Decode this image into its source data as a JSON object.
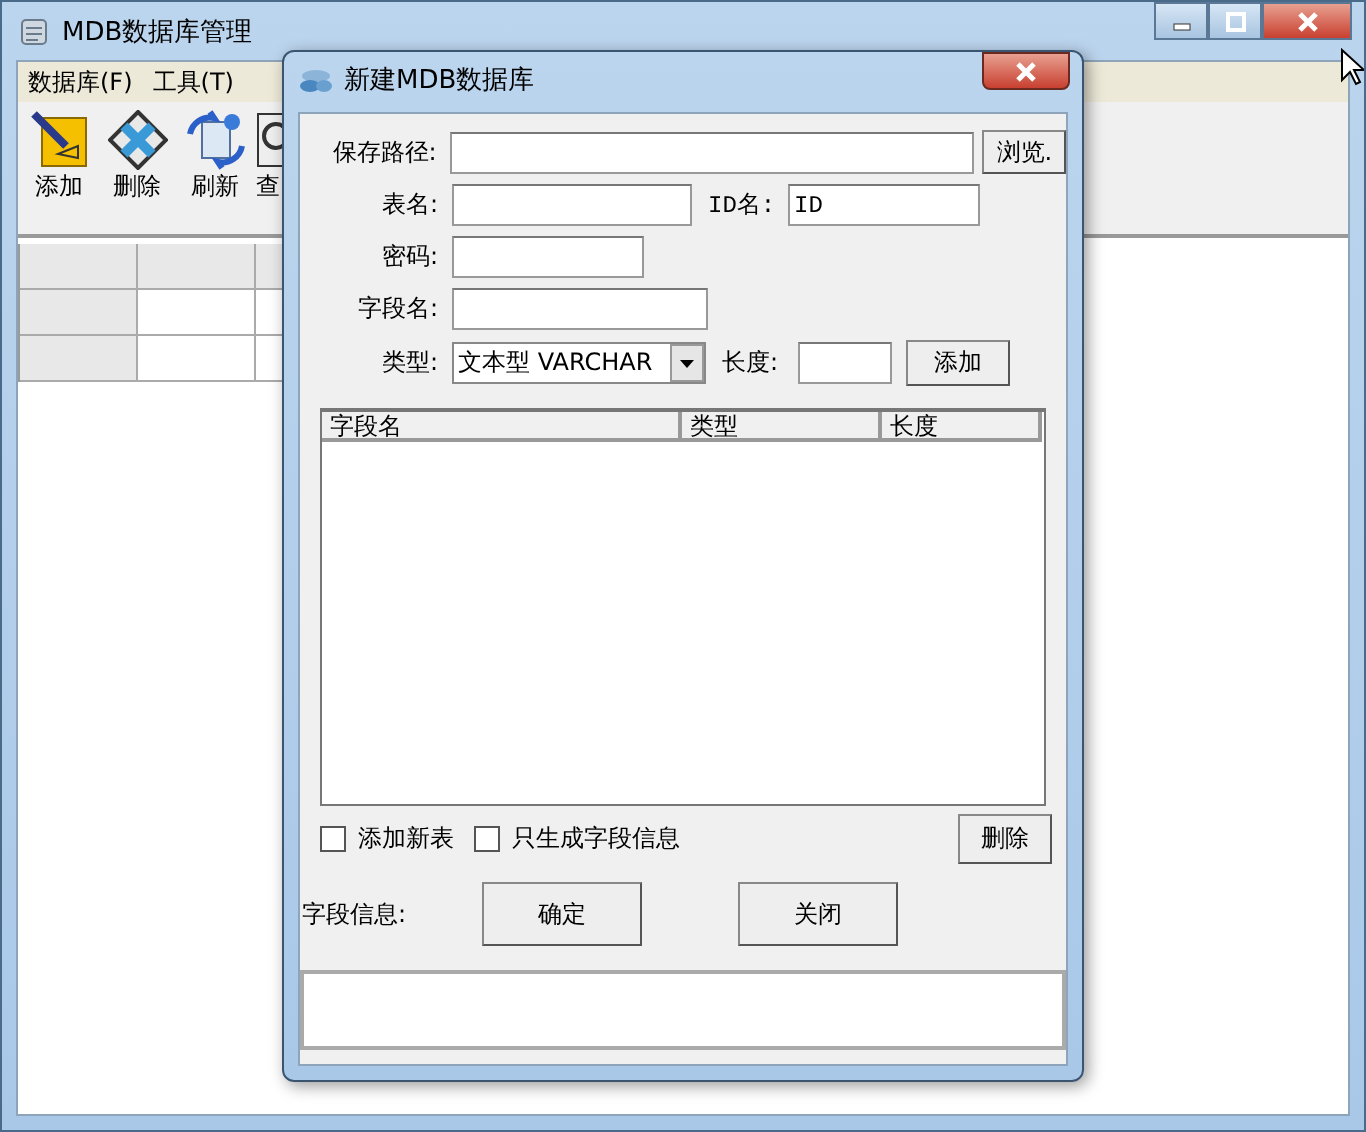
{
  "main_window": {
    "title": "MDB数据库管理",
    "menu": [
      {
        "label": "数据库(F)"
      },
      {
        "label": "工具(T)"
      }
    ],
    "toolbar": [
      {
        "kind": "add",
        "label": "添加"
      },
      {
        "kind": "delete",
        "label": "删除"
      },
      {
        "kind": "refresh",
        "label": "刷新"
      },
      {
        "kind": "query",
        "label": "查"
      }
    ]
  },
  "dialog": {
    "title": "新建MDB数据库",
    "save_path": {
      "label": "保存路径:",
      "browse": "浏览."
    },
    "table_name": {
      "label": "表名:"
    },
    "id_name": {
      "label": "ID名:",
      "value": "ID"
    },
    "password": {
      "label": "密码:"
    },
    "field_name": {
      "label": "字段名:"
    },
    "type": {
      "label": "类型:",
      "value": "文本型 VARCHAR"
    },
    "length": {
      "label": "长度:"
    },
    "add_button": "添加",
    "list_columns": [
      "字段名",
      "类型",
      "长度"
    ],
    "checkboxes": [
      {
        "label": "添加新表",
        "checked": false
      },
      {
        "label": "只生成字段信息",
        "checked": false
      }
    ],
    "delete_button": "删除",
    "field_info_label": "字段信息:",
    "ok_button": "确定",
    "close_button": "关闭"
  }
}
